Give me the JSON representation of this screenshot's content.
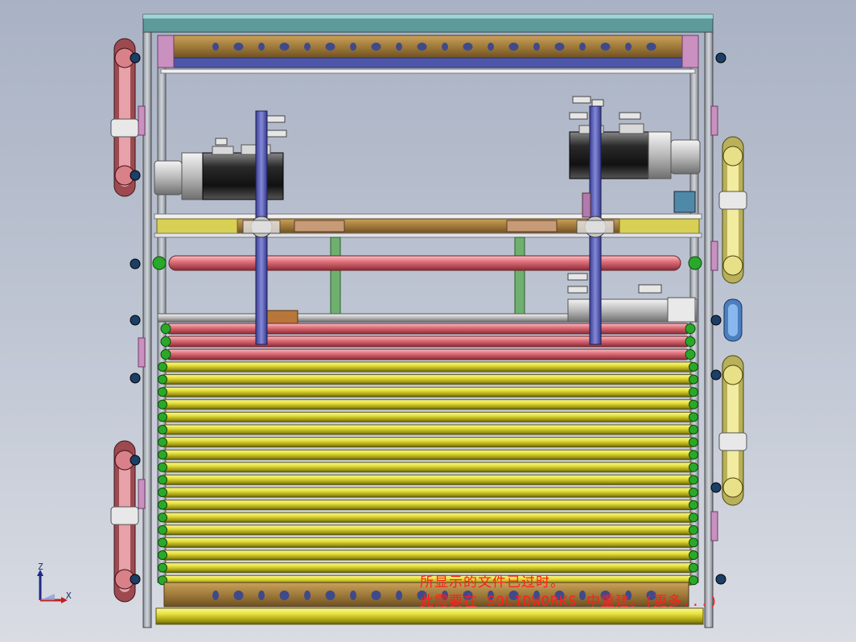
{
  "app": {
    "name": "SOLIDWORKS",
    "view": "front"
  },
  "triad": {
    "z_label": "Z",
    "x_label": "X"
  },
  "notice": {
    "line1": "所显示的文件已过时。",
    "line2": "此需要在 SOLIDWORKS 中重建。(更多...)"
  },
  "colors": {
    "background_top": "#a9b2c4",
    "background_bottom": "#d9dce3",
    "frame": "#b7bdc6",
    "roller_yellow": "#e6e23a",
    "roller_red": "#e0707a",
    "shaft_blue": "#5a5fb8",
    "beam_brown": "#a07a3a",
    "warning_text": "#ff1e1e"
  },
  "model": {
    "yellow_roller_count": 18,
    "red_roller_count": 3,
    "servo_motor_count": 2
  }
}
